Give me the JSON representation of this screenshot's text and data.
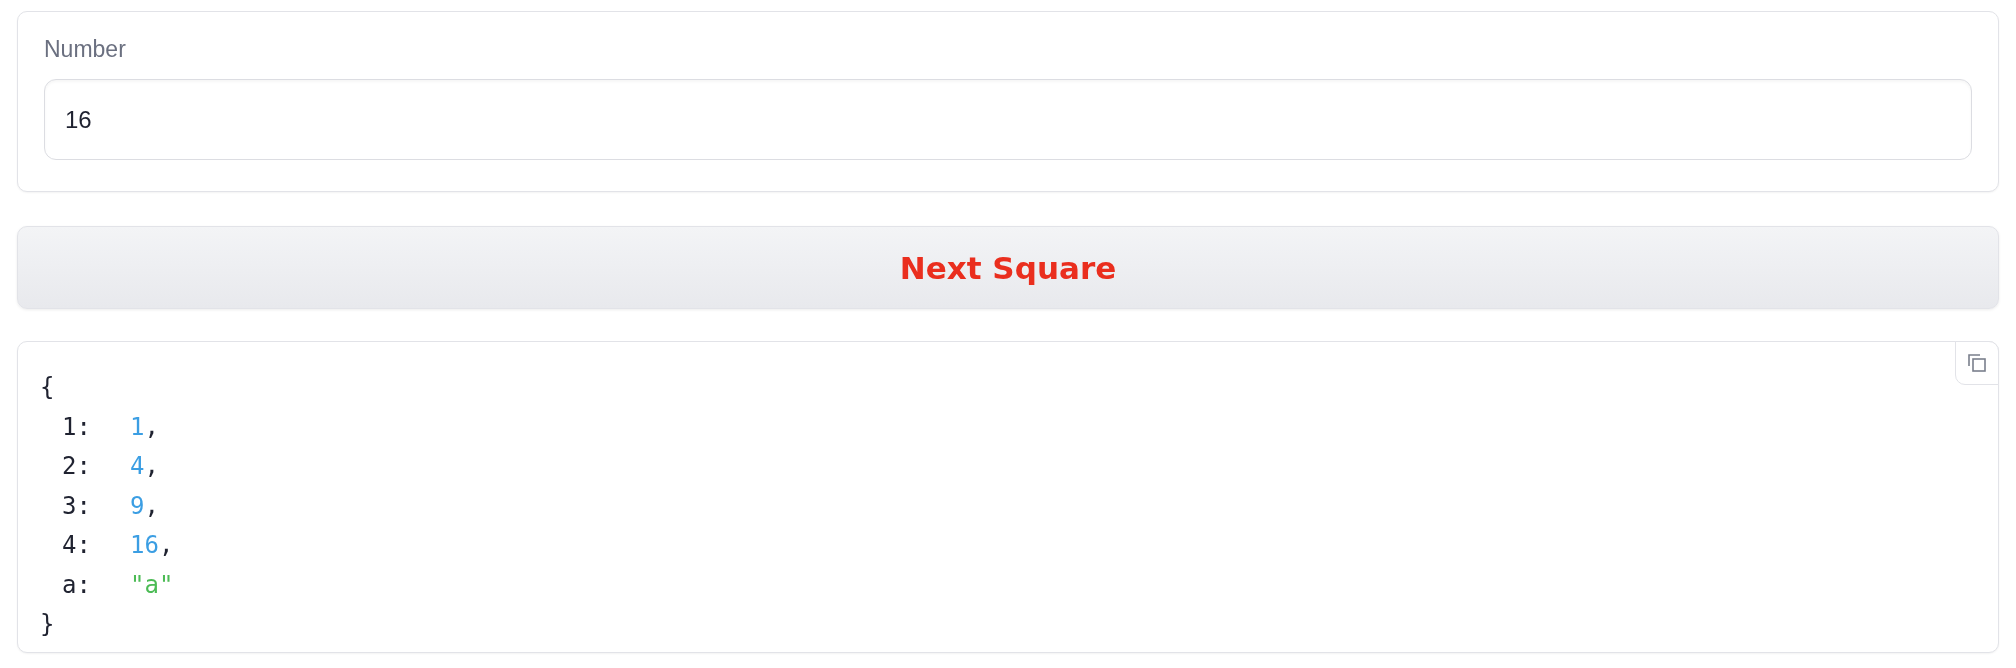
{
  "number_field": {
    "label": "Number",
    "value": "16"
  },
  "next_button": {
    "label": "Next Square"
  },
  "json_output": {
    "open": "{",
    "close": "}",
    "entries": [
      {
        "key": "1:",
        "value": "1",
        "kind": "number",
        "comma": ","
      },
      {
        "key": "2:",
        "value": "4",
        "kind": "number",
        "comma": ","
      },
      {
        "key": "3:",
        "value": "9",
        "kind": "number",
        "comma": ","
      },
      {
        "key": "4:",
        "value": "16",
        "kind": "number",
        "comma": ","
      },
      {
        "key": "a:",
        "value": "\"a\"",
        "kind": "string"
      }
    ]
  }
}
